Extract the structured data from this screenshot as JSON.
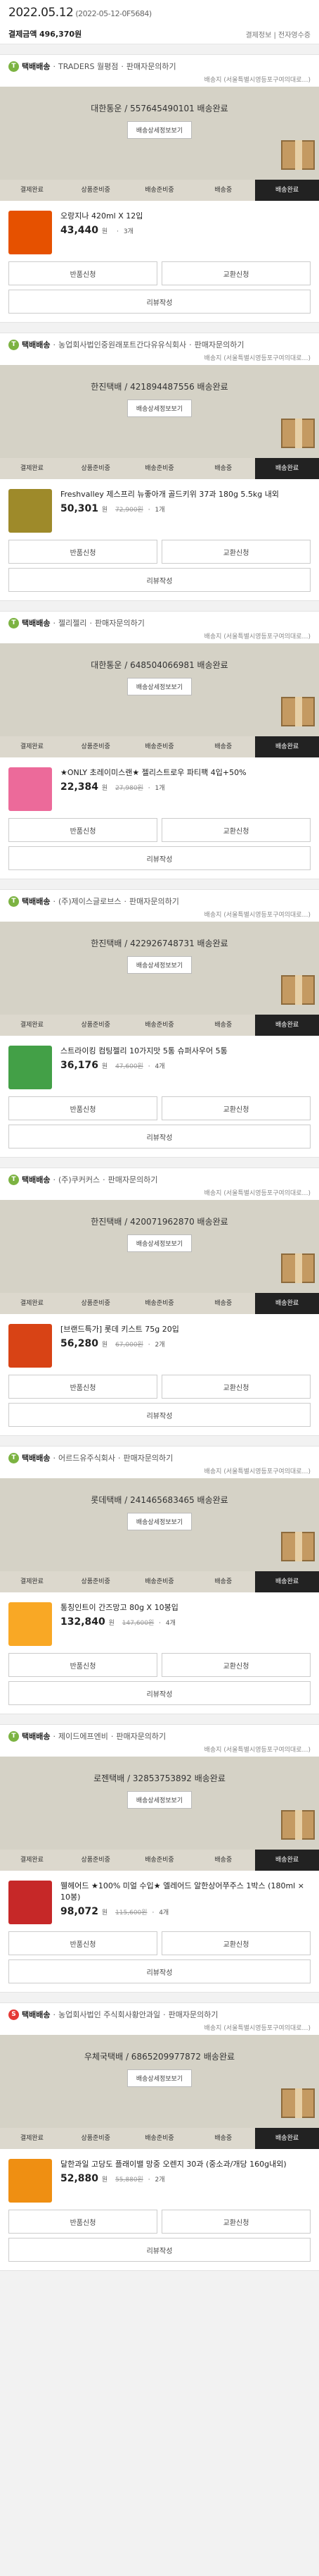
{
  "header": {
    "date": "2022.05.12",
    "order_no": "(2022-05-12-0F5684)",
    "total_label": "결제금액",
    "total_value": "496,370원",
    "links": "결제정보 | 전자영수증"
  },
  "labels": {
    "track_btn": "배송상세정보보기",
    "return": "반품신청",
    "exchange": "교환신청",
    "review": "리뷰작성",
    "won": "원",
    "qty_sep": "·"
  },
  "steps": [
    "결제완료",
    "상품준비중",
    "배송준비중",
    "배송중",
    "배송완료"
  ],
  "orders": [
    {
      "badge": "T",
      "type": "택배배송",
      "seller": "TRADERS 월평점",
      "contact": "판매자문의하기",
      "address": "배송지 (서울특별시영등포구여의대로…)",
      "tracking": "대한통운 / 557645490101 배송완료",
      "name": "오랑지나 420ml X 12입",
      "price": "43,440",
      "orig": "",
      "qty": "3개",
      "thumb": "#e65100"
    },
    {
      "badge": "T",
      "type": "택배배송",
      "seller": "농업회사법인중원래포트간다유유식회사",
      "contact": "판매자문의하기",
      "address": "배송지 (서울특별시영등포구여의대로…)",
      "tracking": "한진택배 / 421894487556 배송완료",
      "name": "Freshvalley 제스프리 뉴좋아개 골드키위 37과 180g 5.5kg 내외",
      "price": "50,301",
      "orig": "72,900원",
      "qty": "1개",
      "thumb": "#9e8a2a"
    },
    {
      "badge": "T",
      "type": "택배배송",
      "seller": "젤리젤리",
      "contact": "판매자문의하기",
      "address": "배송지 (서울특별시영등포구여의대로…)",
      "tracking": "대한통운 / 648504066981 배송완료",
      "name": "★ONLY 초레이미스랜★ 젤리스트로우 파티팩 4입+50%",
      "price": "22,384",
      "orig": "27,980원",
      "qty": "1개",
      "thumb": "#ec6a9a"
    },
    {
      "badge": "T",
      "type": "택배배송",
      "seller": "(주)제이스글로브스",
      "contact": "판매자문의하기",
      "address": "배송지 (서울특별시영등포구여의대로…)",
      "tracking": "한진택배 / 422926748731 배송완료",
      "name": "스트라이킹 컴팅젤리 10가지맛 5통 슈퍼사우어 5통",
      "price": "36,176",
      "orig": "47,600원",
      "qty": "4개",
      "thumb": "#43a047"
    },
    {
      "badge": "T",
      "type": "택배배송",
      "seller": "(주)쿠커커스",
      "contact": "판매자문의하기",
      "address": "배송지 (서울특별시영등포구여의대로…)",
      "tracking": "한진택배 / 420071962870 배송완료",
      "name": "[브랜드특가] 롯데 키스트 75g 20입",
      "price": "56,280",
      "orig": "67,000원",
      "qty": "2개",
      "thumb": "#d84315"
    },
    {
      "badge": "T",
      "type": "택배배송",
      "seller": "어르드유주식회사",
      "contact": "판매자문의하기",
      "address": "배송지 (서울특별시영등포구여의대로…)",
      "tracking": "롯데택배 / 241465683465 배송완료",
      "name": "통칭인트이 간즈망고 80g X 10봉입",
      "price": "132,840",
      "orig": "147,600원",
      "qty": "4개",
      "thumb": "#f9a825"
    },
    {
      "badge": "T",
      "type": "택배배송",
      "seller": "제이드에프엔비",
      "contact": "판매자문의하기",
      "address": "배송지 (서울특별시영등포구여의대로…)",
      "tracking": "로젠택배 / 32853753892 배송완료",
      "name": "웰헤어드 ★100% 미얼 수입★ 엘레어드 알한상어쭈주스 1박스 (180ml × 10봉)",
      "price": "98,072",
      "orig": "115,600원",
      "qty": "4개",
      "thumb": "#c62828"
    },
    {
      "badge": "S",
      "type": "택배배송",
      "seller": "농업회사법인 주식회사황안과일",
      "contact": "판매자문의하기",
      "address": "배송지 (서울특별시영등포구여의대로…)",
      "tracking": "우체국택배 / 6865209977872 배송완료",
      "name": "달한과일 고당도 플래이밸 망중 오렌지 30과 (중소과/개당 160g내외)",
      "price": "52,880",
      "orig": "55,880원",
      "qty": "2개",
      "thumb": "#ef8f12"
    }
  ]
}
